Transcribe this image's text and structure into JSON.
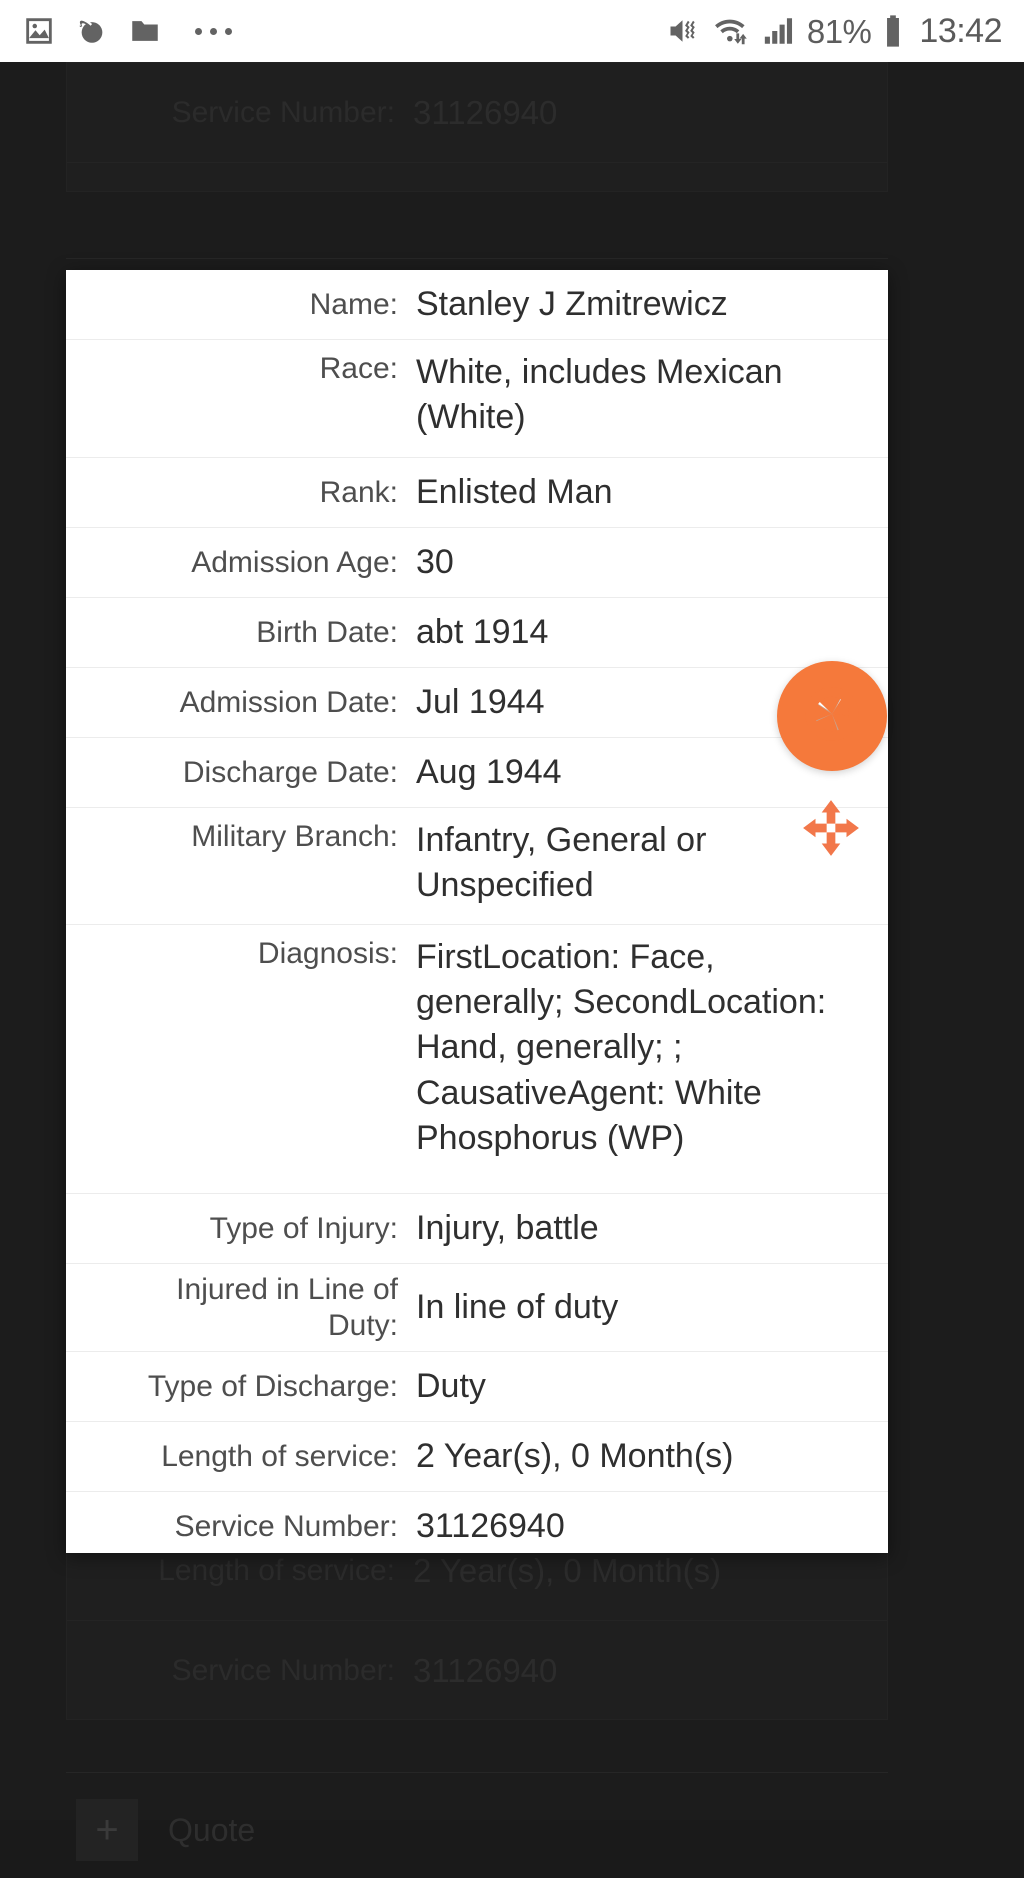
{
  "status_bar": {
    "left_icons": [
      "image-icon",
      "browser-icon",
      "folder-icon",
      "overflow-dots-icon"
    ],
    "right_icons": [
      "mute-vibrate-icon",
      "wifi-icon",
      "signal-bars-icon",
      "battery-icon"
    ],
    "battery_percent": "81%",
    "clock": "13:42"
  },
  "background": {
    "rows": [
      {
        "label": "Service Number:",
        "value": "31126940"
      }
    ],
    "bottom_rows": [
      {
        "label": "Length of service:",
        "value": "2 Year(s), 0 Month(s)"
      },
      {
        "label": "Service Number:",
        "value": "31126940"
      }
    ],
    "quote_label": "Quote",
    "quote_plus": "+"
  },
  "card": {
    "rows": [
      {
        "label": "Name:",
        "value": "Stanley J Zmitrewicz"
      },
      {
        "label": "Race:",
        "value": "White, includes Mexican (White)"
      },
      {
        "label": "Rank:",
        "value": "Enlisted Man"
      },
      {
        "label": "Admission Age:",
        "value": "30"
      },
      {
        "label": "Birth Date:",
        "value": "abt 1914"
      },
      {
        "label": "Admission Date:",
        "value": "Jul 1944"
      },
      {
        "label": "Discharge Date:",
        "value": "Aug 1944"
      },
      {
        "label": "Military Branch:",
        "value": "Infantry, General or Unspecified"
      },
      {
        "label": "Diagnosis:",
        "value": "FirstLocation: Face, generally; SecondLocation: Hand, generally; ; CausativeAgent: White Phosphorus (WP)"
      },
      {
        "label": "Type of Injury:",
        "value": "Injury, battle"
      },
      {
        "label": "Injured in Line of Duty:",
        "value": "In line of duty"
      },
      {
        "label": "Type of Discharge:",
        "value": "Duty"
      },
      {
        "label": "Length of service:",
        "value": "2 Year(s), 0 Month(s)"
      },
      {
        "label": "Service Number:",
        "value": "31126940"
      }
    ]
  },
  "floating_controls": {
    "shutter_button": "screenshot-capture-button",
    "move_handle": "move-drag-handle"
  },
  "colors": {
    "accent_orange": "#f5793b",
    "card_background": "#ffffff",
    "page_background": "#1c1c1c",
    "status_bar_background": "#ffffff",
    "label_text": "#4e4e4e",
    "value_text": "#2f2f2f"
  }
}
